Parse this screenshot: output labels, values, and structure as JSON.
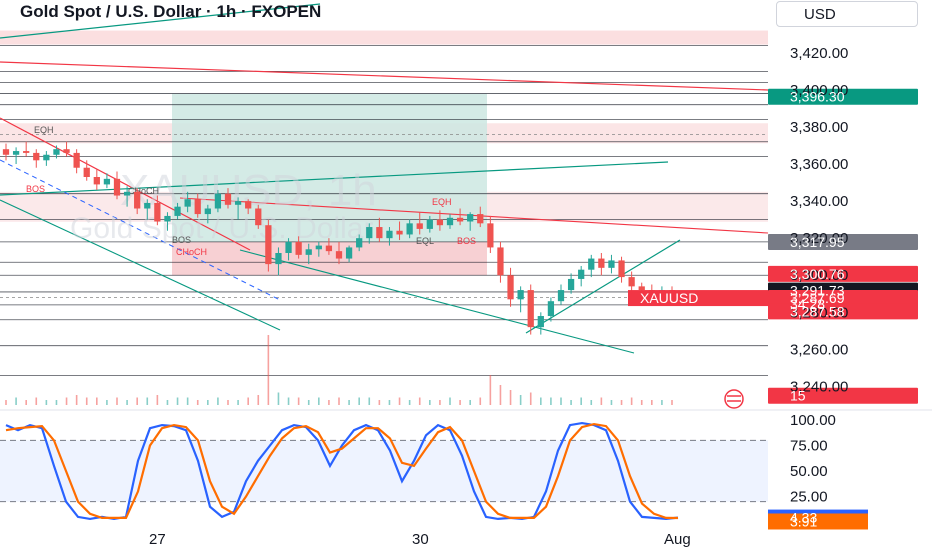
{
  "header": {
    "title": "Gold Spot / U.S. Dollar · 1h · FXOPEN",
    "currency": "USD"
  },
  "watermark": {
    "line1": "XAUUSD, 1h",
    "line2": "Gold Spot / U.S. Dollar"
  },
  "annotations": [
    "EQH",
    "BOS",
    "CHoCH",
    "CHoCH",
    "BOS",
    "EQH",
    "EQL",
    "BOS"
  ],
  "colors": {
    "up": "#26a69a",
    "down": "#ef5350",
    "stoch_k": "#2962ff",
    "stoch_d": "#ff6d00",
    "axis_text": "#131722"
  },
  "chart_data": [
    {
      "type": "line",
      "title": "XAUUSD 1h price",
      "y_ticks": [
        "3,420.00",
        "3,400.00",
        "3,380.00",
        "3,360.00",
        "3,340.00",
        "3,320.00",
        "3,300.00",
        "3,280.00",
        "3,260.00",
        "3,240.00"
      ],
      "ylim": [
        3230,
        3435
      ],
      "x_ticks": [
        "27",
        "30",
        "Aug"
      ],
      "price_labels": [
        {
          "text": "3,396.30",
          "value": 3396.3,
          "style": "green"
        },
        {
          "text": "3,317.95",
          "value": 3317.95,
          "style": "gray"
        },
        {
          "text": "3,300.76",
          "value": 3300.76,
          "style": "red"
        },
        {
          "text": "3,291.73",
          "value": 3291.73,
          "style": "dark"
        },
        {
          "text": "XAUUSD",
          "value": 3287.69,
          "style": "red"
        },
        {
          "text": "3,287.69",
          "value": 3287.69,
          "style": "red"
        },
        {
          "text": "34:28",
          "value": 3284.5,
          "style": "red"
        },
        {
          "text": "3,287.58",
          "value": 3280.5,
          "style": "red"
        },
        {
          "text": "15",
          "value": 3235,
          "style": "red"
        }
      ],
      "candles": [
        [
          3368,
          3371,
          3362,
          3365
        ],
        [
          3365,
          3369,
          3360,
          3367
        ],
        [
          3367,
          3372,
          3364,
          3366
        ],
        [
          3366,
          3368,
          3358,
          3362
        ],
        [
          3362,
          3367,
          3359,
          3365
        ],
        [
          3365,
          3370,
          3363,
          3368
        ],
        [
          3368,
          3372,
          3364,
          3366
        ],
        [
          3366,
          3368,
          3355,
          3358
        ],
        [
          3358,
          3362,
          3351,
          3353
        ],
        [
          3353,
          3357,
          3346,
          3349
        ],
        [
          3349,
          3355,
          3347,
          3352
        ],
        [
          3352,
          3356,
          3341,
          3343
        ],
        [
          3343,
          3348,
          3337,
          3345
        ],
        [
          3345,
          3347,
          3333,
          3336
        ],
        [
          3336,
          3341,
          3330,
          3339
        ],
        [
          3339,
          3343,
          3327,
          3329
        ],
        [
          3329,
          3334,
          3324,
          3332
        ],
        [
          3332,
          3339,
          3330,
          3337
        ],
        [
          3337,
          3345,
          3334,
          3341
        ],
        [
          3341,
          3344,
          3331,
          3333
        ],
        [
          3333,
          3338,
          3328,
          3336
        ],
        [
          3336,
          3346,
          3334,
          3344
        ],
        [
          3344,
          3347,
          3336,
          3338
        ],
        [
          3338,
          3342,
          3330,
          3340
        ],
        [
          3340,
          3341,
          3333,
          3336
        ],
        [
          3336,
          3338,
          3325,
          3327
        ],
        [
          3327,
          3330,
          3302,
          3306
        ],
        [
          3306,
          3315,
          3300,
          3312
        ],
        [
          3312,
          3320,
          3308,
          3318
        ],
        [
          3318,
          3321,
          3309,
          3311
        ],
        [
          3311,
          3317,
          3306,
          3314
        ],
        [
          3314,
          3318,
          3310,
          3316
        ],
        [
          3316,
          3320,
          3311,
          3313
        ],
        [
          3313,
          3318,
          3306,
          3309
        ],
        [
          3309,
          3316,
          3307,
          3315
        ],
        [
          3315,
          3322,
          3313,
          3320
        ],
        [
          3320,
          3328,
          3317,
          3326
        ],
        [
          3326,
          3331,
          3318,
          3320
        ],
        [
          3320,
          3326,
          3316,
          3324
        ],
        [
          3324,
          3329,
          3319,
          3322
        ],
        [
          3322,
          3330,
          3320,
          3328
        ],
        [
          3328,
          3334,
          3322,
          3325
        ],
        [
          3325,
          3332,
          3323,
          3330
        ],
        [
          3330,
          3335,
          3324,
          3327
        ],
        [
          3327,
          3333,
          3325,
          3331
        ],
        [
          3331,
          3336,
          3327,
          3329
        ],
        [
          3329,
          3334,
          3324,
          3333
        ],
        [
          3333,
          3337,
          3326,
          3328
        ],
        [
          3328,
          3332,
          3312,
          3315
        ],
        [
          3315,
          3318,
          3296,
          3300
        ],
        [
          3300,
          3304,
          3283,
          3287
        ],
        [
          3287,
          3294,
          3280,
          3292
        ],
        [
          3292,
          3295,
          3268,
          3272
        ],
        [
          3272,
          3280,
          3268,
          3278
        ],
        [
          3278,
          3288,
          3275,
          3286
        ],
        [
          3286,
          3295,
          3284,
          3292
        ],
        [
          3292,
          3301,
          3290,
          3298
        ],
        [
          3298,
          3305,
          3294,
          3303
        ],
        [
          3303,
          3311,
          3299,
          3309
        ],
        [
          3309,
          3312,
          3300,
          3304
        ],
        [
          3304,
          3311,
          3301,
          3308
        ],
        [
          3308,
          3310,
          3296,
          3299
        ],
        [
          3299,
          3302,
          3290,
          3294
        ],
        [
          3294,
          3296,
          3288,
          3292
        ],
        [
          3292,
          3295,
          3287,
          3290
        ],
        [
          3290,
          3294,
          3286,
          3292
        ],
        [
          3292,
          3294,
          3287,
          3288
        ]
      ],
      "volume": [
        2,
        3,
        2,
        3,
        2,
        2,
        3,
        4,
        3,
        3,
        2,
        3,
        2,
        3,
        3,
        4,
        2,
        3,
        3,
        2,
        2,
        3,
        2,
        2,
        3,
        4,
        28,
        5,
        3,
        3,
        2,
        3,
        2,
        3,
        2,
        3,
        3,
        2,
        2,
        3,
        2,
        3,
        2,
        2,
        3,
        2,
        2,
        3,
        12,
        8,
        6,
        4,
        5,
        3,
        3,
        3,
        2,
        3,
        2,
        3,
        2,
        2,
        3,
        2,
        2,
        2,
        2
      ]
    },
    {
      "type": "line",
      "title": "Stochastic",
      "y_ticks": [
        "100.00",
        "75.00",
        "50.00",
        "25.00"
      ],
      "ylim": [
        0,
        100
      ],
      "bands": [
        20,
        80
      ],
      "series": [
        {
          "name": "%K",
          "values": [
            95,
            90,
            95,
            92,
            55,
            20,
            5,
            3,
            5,
            3,
            5,
            60,
            92,
            95,
            94,
            90,
            60,
            15,
            5,
            10,
            40,
            60,
            75,
            90,
            95,
            93,
            80,
            55,
            75,
            90,
            95,
            90,
            70,
            40,
            60,
            85,
            95,
            90,
            65,
            30,
            5,
            3,
            4,
            3,
            5,
            30,
            70,
            95,
            97,
            95,
            90,
            60,
            20,
            5,
            4,
            3,
            4.33
          ]
        },
        {
          "name": "%D",
          "values": [
            90,
            92,
            93,
            94,
            80,
            50,
            20,
            8,
            4,
            4,
            4,
            30,
            75,
            92,
            95,
            93,
            80,
            40,
            15,
            8,
            25,
            45,
            65,
            82,
            92,
            94,
            88,
            68,
            72,
            82,
            92,
            92,
            82,
            58,
            55,
            72,
            88,
            93,
            80,
            50,
            20,
            8,
            4,
            4,
            4,
            15,
            45,
            80,
            93,
            96,
            94,
            80,
            45,
            18,
            8,
            4,
            3.91
          ]
        }
      ],
      "price_labels": [
        {
          "text": "4.33",
          "value": 4.33,
          "style": "blue"
        },
        {
          "text": "3.91",
          "value": 0.5,
          "style": "orange"
        }
      ]
    }
  ]
}
